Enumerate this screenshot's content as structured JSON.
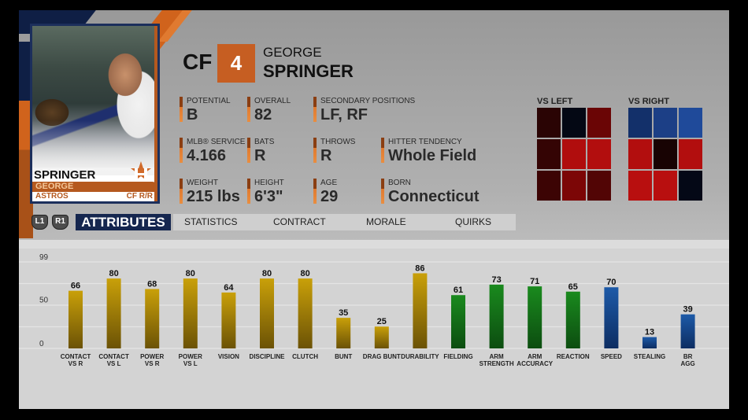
{
  "player": {
    "position": "CF",
    "jersey_number": "4",
    "first_name": "GEORGE",
    "last_name": "SPRINGER"
  },
  "card": {
    "last_name": "SPRINGER",
    "first_name": "GEORGE",
    "team": "ASTROS",
    "position_bats_throws": "CF  R/R",
    "accent_color": "#b5591f",
    "border_color": "#1c2f5c"
  },
  "info": [
    {
      "label": "POTENTIAL",
      "value": "B"
    },
    {
      "label": "OVERALL",
      "value": "82"
    },
    {
      "label": "SECONDARY POSITIONS",
      "value": "LF, RF"
    },
    {
      "label": "MLB® SERVICE",
      "value": "4.166"
    },
    {
      "label": "BATS",
      "value": "R"
    },
    {
      "label": "THROWS",
      "value": "R"
    },
    {
      "label": "HITTER TENDENCY",
      "value": "Whole Field"
    },
    {
      "label": "WEIGHT",
      "value": "215 lbs"
    },
    {
      "label": "HEIGHT",
      "value": "6'3\""
    },
    {
      "label": "AGE",
      "value": "29"
    },
    {
      "label": "BORN",
      "value": "Connecticut"
    }
  ],
  "hot_zones": {
    "vs_left": {
      "title": "VS LEFT",
      "colors": [
        "#2a0404",
        "#040814",
        "#6a0505",
        "#340404",
        "#b00d0d",
        "#b20e0e",
        "#3c0404",
        "#7c0606",
        "#520505"
      ]
    },
    "vs_right": {
      "title": "VS RIGHT",
      "colors": [
        "#13306a",
        "#1c3f86",
        "#1f4a9a",
        "#b20e0e",
        "#180303",
        "#b20e0e",
        "#b80f0f",
        "#b80f0f",
        "#040816"
      ]
    }
  },
  "tabs": {
    "shoulder_left": "L1",
    "shoulder_right": "R1",
    "active": "ATTRIBUTES",
    "items": [
      "STATISTICS",
      "CONTRACT",
      "MORALE",
      "QUIRKS"
    ]
  },
  "colors": {
    "hitting": [
      "#c9a009",
      "#6b5206"
    ],
    "fielding": [
      "#1a8a1e",
      "#0c4d10"
    ],
    "running": [
      "#1d5aa8",
      "#0d2d62"
    ],
    "accent_orange": "#c65e22",
    "navy": "#15264f"
  },
  "chart_data": {
    "type": "bar",
    "title": "ATTRIBUTES",
    "xlabel": "",
    "ylabel": "",
    "ylim": [
      0,
      99
    ],
    "yticks": [
      0,
      50,
      99
    ],
    "grid": true,
    "categories": [
      [
        "CONTACT",
        "VS R"
      ],
      [
        "CONTACT",
        "VS L"
      ],
      [
        "POWER",
        "VS R"
      ],
      [
        "POWER",
        "VS L"
      ],
      [
        "VISION"
      ],
      [
        "DISCIPLINE"
      ],
      [
        "CLUTCH"
      ],
      [
        "BUNT"
      ],
      [
        "DRAG BUNT"
      ],
      [
        "DURABILITY"
      ],
      [
        "FIELDING"
      ],
      [
        "ARM",
        "STRENGTH"
      ],
      [
        "ARM",
        "ACCURACY"
      ],
      [
        "REACTION"
      ],
      [
        "SPEED"
      ],
      [
        "STEALING"
      ],
      [
        "BR",
        "AGG"
      ]
    ],
    "values": [
      66,
      80,
      68,
      80,
      64,
      80,
      80,
      35,
      25,
      86,
      61,
      73,
      71,
      65,
      70,
      13,
      39
    ],
    "groups": [
      "hitting",
      "hitting",
      "hitting",
      "hitting",
      "hitting",
      "hitting",
      "hitting",
      "hitting",
      "hitting",
      "hitting",
      "fielding",
      "fielding",
      "fielding",
      "fielding",
      "running",
      "running",
      "running"
    ]
  }
}
